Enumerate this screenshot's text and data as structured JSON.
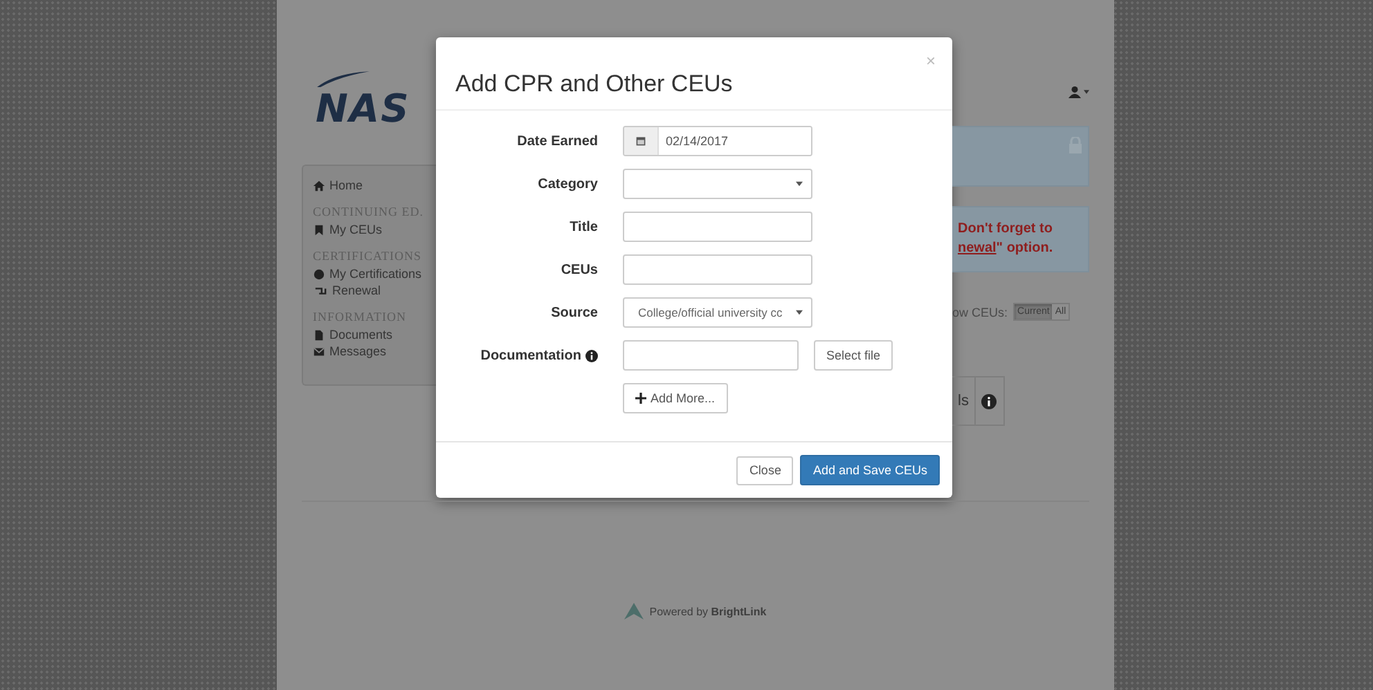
{
  "header": {
    "logo": "NAS"
  },
  "sidebar": {
    "items": [
      {
        "kind": "link",
        "label": "Home"
      },
      {
        "kind": "heading",
        "label": "CONTINUING ED."
      },
      {
        "kind": "link",
        "label": "My CEUs"
      },
      {
        "kind": "heading",
        "label": "CERTIFICATIONS"
      },
      {
        "kind": "link",
        "label": "My Certifications"
      },
      {
        "kind": "link",
        "label": "Renewal"
      },
      {
        "kind": "heading",
        "label": "INFORMATION"
      },
      {
        "kind": "link",
        "label": "Documents"
      },
      {
        "kind": "link",
        "label": "Messages"
      }
    ]
  },
  "alerts": [
    {
      "kind": "info"
    },
    {
      "kind": "warning",
      "text": "Don't forget to",
      "link": "newal",
      "after": "\" option."
    }
  ],
  "show_ceus": {
    "label": "ow CEUs:",
    "options": [
      {
        "label": "Current",
        "selected": true
      },
      {
        "label": "All",
        "selected": false
      }
    ]
  },
  "tab_fragment": {
    "label": "ls"
  },
  "footer": {
    "text": "Powered by **BrightLink**"
  },
  "modal": {
    "title": "Add CPR and Other CEUs",
    "close": "×",
    "fields": [
      {
        "kind": "date",
        "label": "Date Earned",
        "value": "02/14/2017"
      },
      {
        "kind": "select",
        "label": "Category"
      },
      {
        "kind": "text",
        "label": "Title"
      },
      {
        "kind": "text",
        "label": "CEUs"
      },
      {
        "kind": "select",
        "label": "Source",
        "value": "College/official university cc"
      },
      {
        "kind": "file",
        "label": "Documentation",
        "info": true,
        "button": "Select file"
      }
    ],
    "add_more": "Add More...",
    "buttons": [
      {
        "kind": "default",
        "label": "Close"
      },
      {
        "kind": "primary",
        "label": "Add and Save CEUs"
      }
    ]
  }
}
